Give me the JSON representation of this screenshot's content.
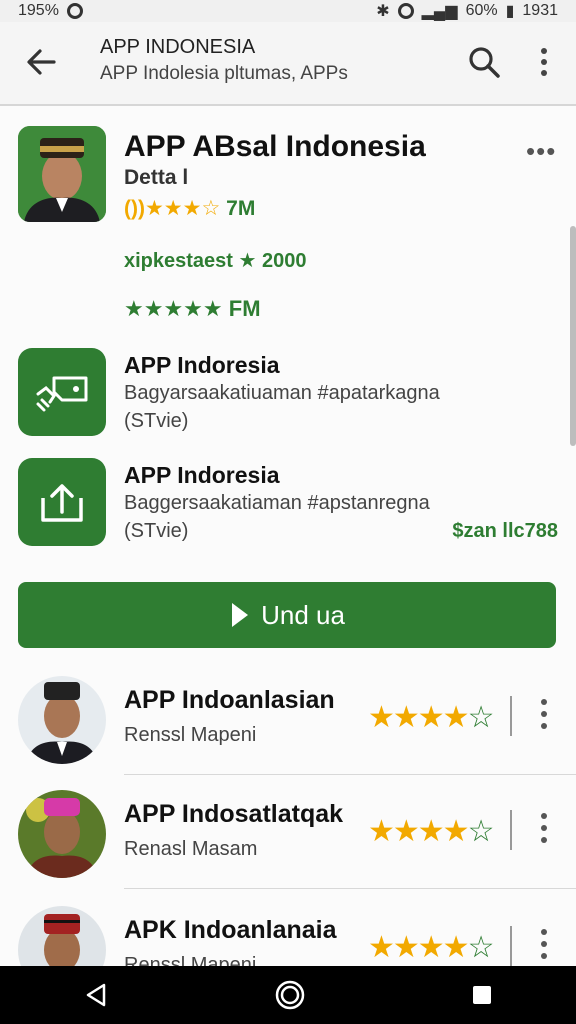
{
  "status": {
    "time_left": "195%",
    "battery": "60%",
    "time_right": "1931"
  },
  "appbar": {
    "title": "APP INDONESIA",
    "subtitle": "APP Indolesia pltumas, APPs"
  },
  "hero": {
    "title": "APP ABsal Indonesia",
    "subtitle": "Detta l",
    "rating_prefix": "())",
    "rating_stars": "★★★☆",
    "rating_count": "7M",
    "promo": "xipkestaest ★ 2000",
    "promo_stars": "★★★★★",
    "promo_count": "FM"
  },
  "features": [
    {
      "name": "APP Indoresia",
      "desc": "Bagyarsaakatiuaman #apatarkagna",
      "tag": "(STvie)",
      "price": ""
    },
    {
      "name": "APP Indoresia",
      "desc": "Baggersaakatiaman #apstanregna",
      "tag": "(STvie)",
      "price": "$zan llc788"
    }
  ],
  "cta": {
    "label": "Und ua"
  },
  "list": [
    {
      "name": "APP Indoanlasian",
      "sub": "Renssl Mapeni",
      "stars_full": "★★★★",
      "stars_empty": "☆"
    },
    {
      "name": "APP Indosatlatqak",
      "sub": "Renasl Masam",
      "stars_full": "★★★★",
      "stars_empty": "☆"
    },
    {
      "name": "APK Indoanlanaia",
      "sub": "Renssl Mapeni",
      "stars_full": "★★★★",
      "stars_empty": "☆"
    }
  ],
  "colors": {
    "accent": "#2f7d32",
    "star": "#f2a900"
  }
}
